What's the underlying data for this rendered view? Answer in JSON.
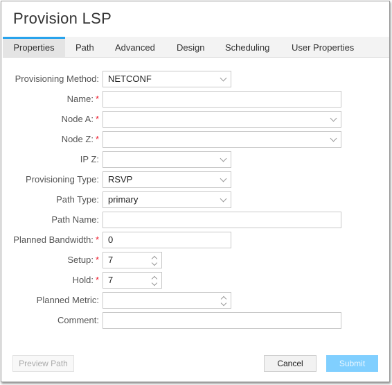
{
  "title": "Provision LSP",
  "tabs": [
    {
      "label": "Properties",
      "active": true
    },
    {
      "label": "Path"
    },
    {
      "label": "Advanced"
    },
    {
      "label": "Design"
    },
    {
      "label": "Scheduling"
    },
    {
      "label": "User Properties"
    }
  ],
  "accent_color": "#29a3ec",
  "form": {
    "provisioning_method": {
      "label": "Provisioning Method:",
      "value": "NETCONF"
    },
    "name": {
      "label": "Name:",
      "value": "",
      "required": "*"
    },
    "node_a": {
      "label": "Node A:",
      "value": "",
      "required": "*"
    },
    "node_z": {
      "label": "Node Z:",
      "value": "",
      "required": "*"
    },
    "ip_z": {
      "label": "IP Z:",
      "value": ""
    },
    "provisioning_type": {
      "label": "Provisioning Type:",
      "value": "RSVP"
    },
    "path_type": {
      "label": "Path Type:",
      "value": "primary"
    },
    "path_name": {
      "label": "Path Name:",
      "value": ""
    },
    "planned_bandwidth": {
      "label": "Planned Bandwidth:",
      "value": "0",
      "required": "*"
    },
    "setup": {
      "label": "Setup:",
      "value": "7",
      "required": "*"
    },
    "hold": {
      "label": "Hold:",
      "value": "7",
      "required": "*"
    },
    "planned_metric": {
      "label": "Planned Metric:",
      "value": ""
    },
    "comment": {
      "label": "Comment:",
      "value": ""
    }
  },
  "buttons": {
    "preview_path": "Preview Path",
    "cancel": "Cancel",
    "submit": "Submit"
  }
}
